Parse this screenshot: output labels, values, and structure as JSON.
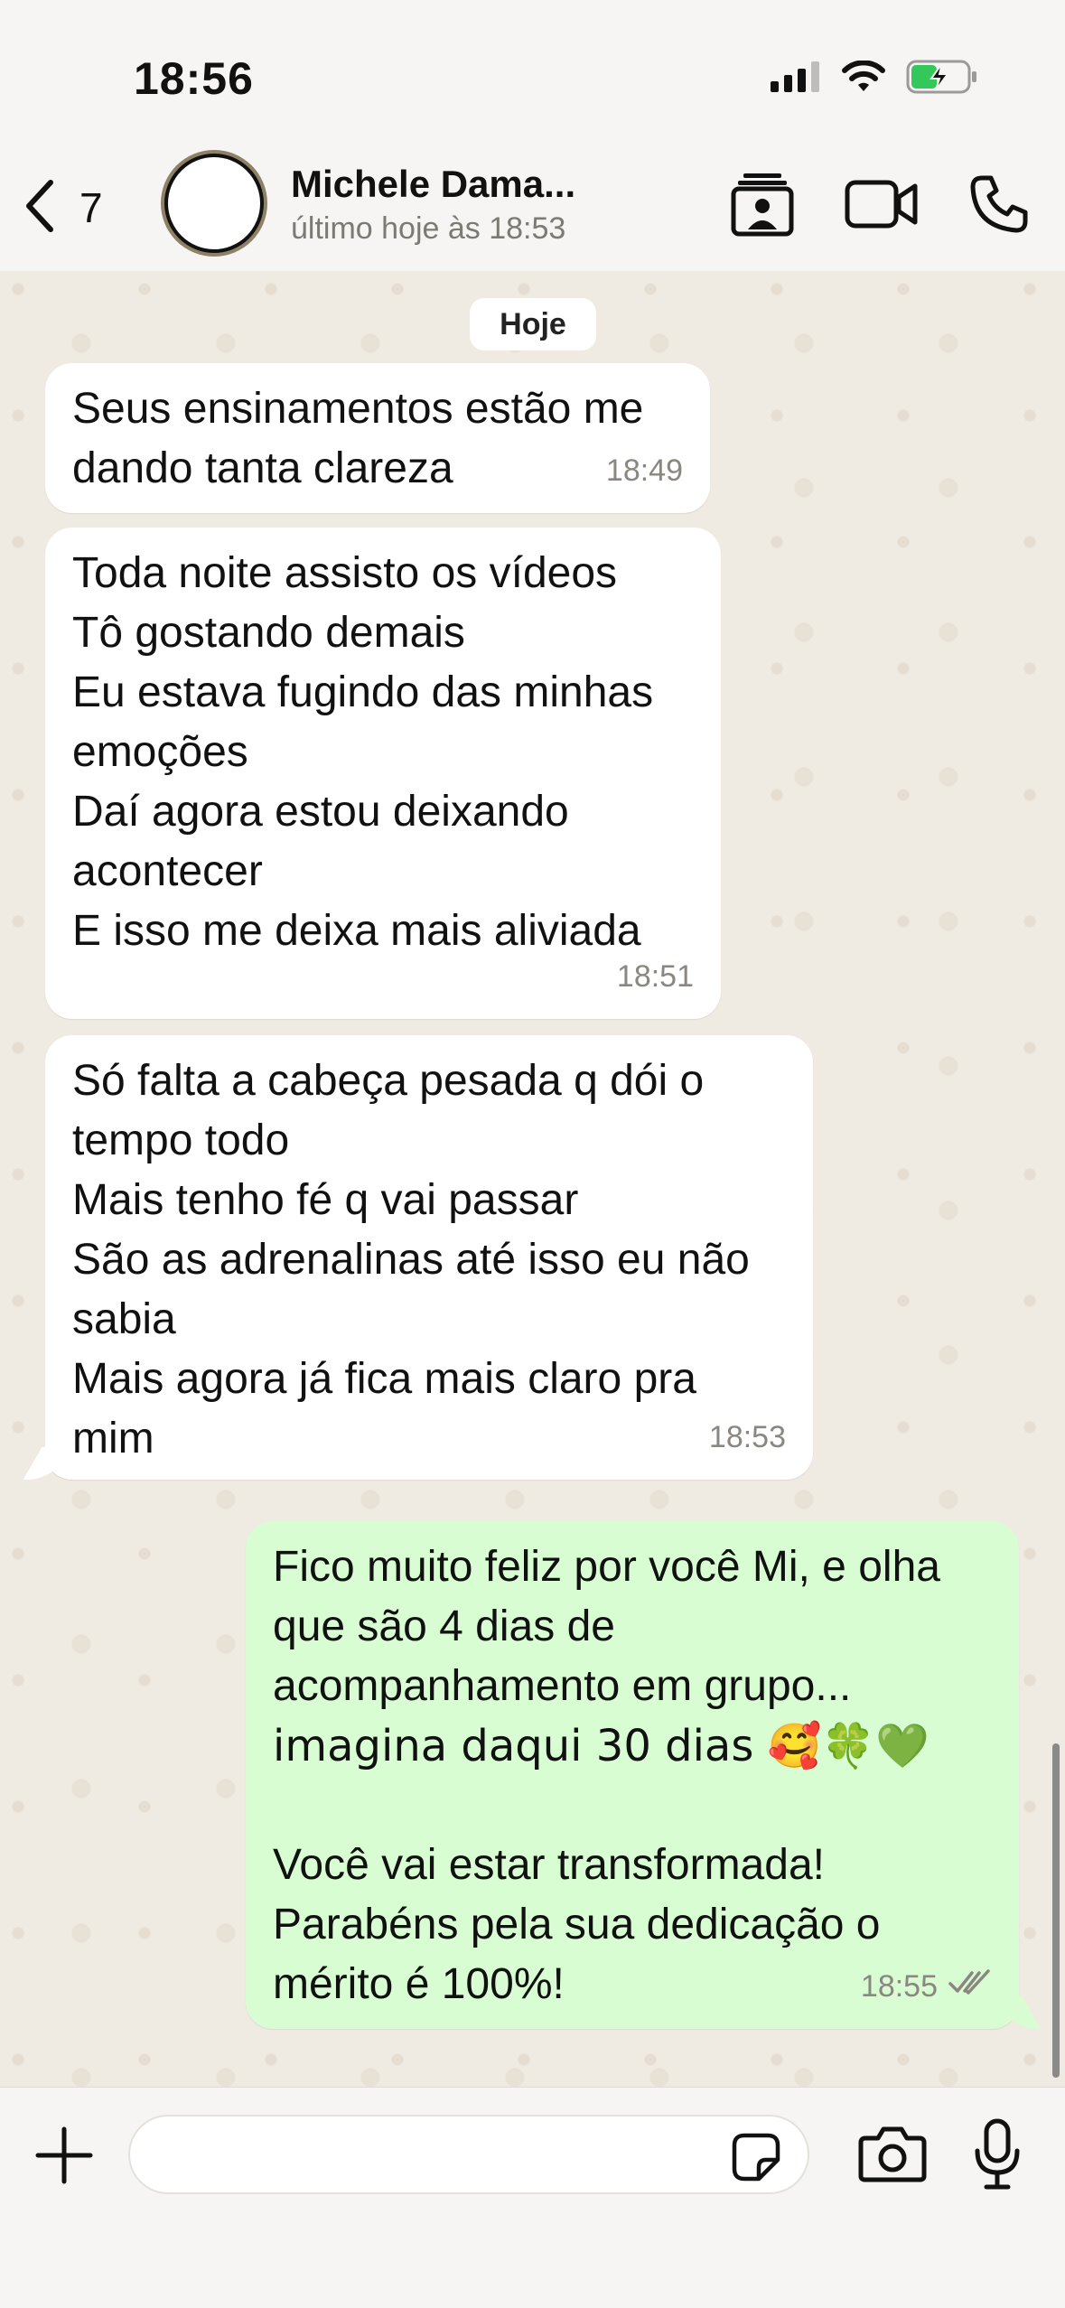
{
  "status_bar": {
    "time": "18:56"
  },
  "header": {
    "back_count": "7",
    "contact_name": "Michele Dama...",
    "contact_status": "último hoje às 18:53"
  },
  "chat": {
    "date_label": "Hoje",
    "messages": [
      {
        "direction": "incoming",
        "lines": [
          "Seus ensinamentos estão me",
          "dando tanta clareza"
        ],
        "time": "18:49"
      },
      {
        "direction": "incoming",
        "lines": [
          "Toda noite assisto os vídeos",
          "Tô gostando demais",
          "Eu estava fugindo das minhas",
          "emoções",
          "Daí agora estou deixando",
          "acontecer",
          "E isso me deixa mais aliviada"
        ],
        "time": "18:51"
      },
      {
        "direction": "incoming",
        "lines": [
          "Só falta a cabeça pesada q dói o",
          "tempo todo",
          "Mais tenho fé q vai passar",
          "São as adrenalinas até isso eu não",
          "sabia",
          "Mais agora já fica mais claro pra",
          "mim"
        ],
        "time": "18:53"
      },
      {
        "direction": "outgoing",
        "lines": [
          "Fico muito feliz por você Mi, e olha",
          "que são 4 dias de",
          "acompanhamento em grupo...",
          "imagina daqui 30 dias 🥰🍀💚",
          "",
          "Você vai estar transformada!",
          "Parabéns pela sua dedicação o",
          "mérito é 100%!"
        ],
        "time": "18:55",
        "status": "read"
      }
    ]
  },
  "composer": {
    "placeholder": ""
  },
  "colors": {
    "outgoing_bubble": "#d9fdd3",
    "incoming_bubble": "#ffffff",
    "chat_background": "#efeae2",
    "read_ticks": "#8a8780"
  },
  "icons": {
    "back": "chevron-left-icon",
    "contact_card": "contact-card-icon",
    "video_call": "video-camera-icon",
    "voice_call": "phone-icon",
    "attach": "plus-icon",
    "sticker": "sticker-icon",
    "camera": "camera-icon",
    "mic": "microphone-icon"
  }
}
